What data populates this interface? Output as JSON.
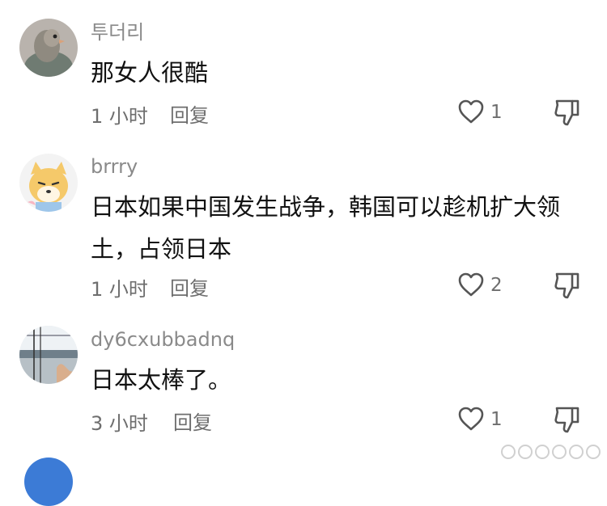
{
  "comments": [
    {
      "username": "투더리",
      "text": "那女人很酷",
      "time": "1 小时",
      "reply": "回复",
      "likes": "1"
    },
    {
      "username": "brrry",
      "text": "日本如果中国发生战争，韩国可以趁机扩大领土，占领日本",
      "time": "1 小时",
      "reply": "回复",
      "likes": "2"
    },
    {
      "username": "dy6cxubbadnq",
      "text": "日本太棒了。",
      "time": "3 小时",
      "reply": "回复",
      "likes": "1"
    }
  ],
  "icons": {
    "like": "heart-outline-icon",
    "dislike": "thumbs-down-icon"
  },
  "colors": {
    "username": "#8a8a8a",
    "meta": "#6e6e6e",
    "text": "#111111"
  }
}
